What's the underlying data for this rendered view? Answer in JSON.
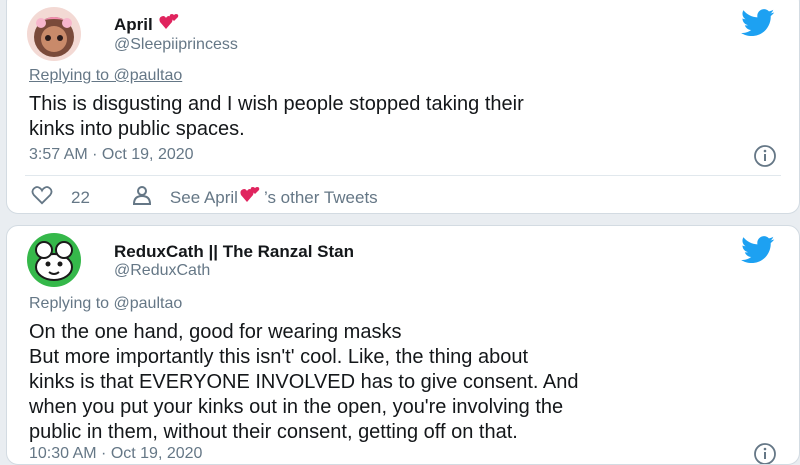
{
  "tweets": [
    {
      "display_name": "April",
      "handle": "@Sleepiiprincess",
      "replying_prefix": "Replying to ",
      "replying_to": "@paultao",
      "text": "This is disgusting and I wish people stopped taking their\nkinks into public spaces.",
      "timestamp": "3:57 AM · Oct 19, 2020",
      "likes": "22",
      "see_prefix": "See April",
      "see_suffix": "’s other Tweets"
    },
    {
      "display_name": "ReduxCath || The Ranzal Stan",
      "handle": "@ReduxCath",
      "replying_prefix": "Replying to ",
      "replying_to": "@paultao",
      "text": "On the one hand, good for wearing masks\nBut more importantly this isn't' cool. Like, the thing about\nkinks is that EVERYONE INVOLVED has to give consent. And\nwhen you put your kinks out in the open, you're involving the\npublic in them, without their consent, getting off on that.",
      "timestamp": "10:30 AM · Oct 19, 2020"
    }
  ],
  "colors": {
    "twitter_blue": "#1da1f2",
    "heart_red": "#e0245e",
    "secondary_text": "#657786"
  },
  "icons": [
    "twitter-bird-icon",
    "two-hearts-emoji-icon",
    "heart-outline-icon",
    "person-icon",
    "info-icon"
  ]
}
